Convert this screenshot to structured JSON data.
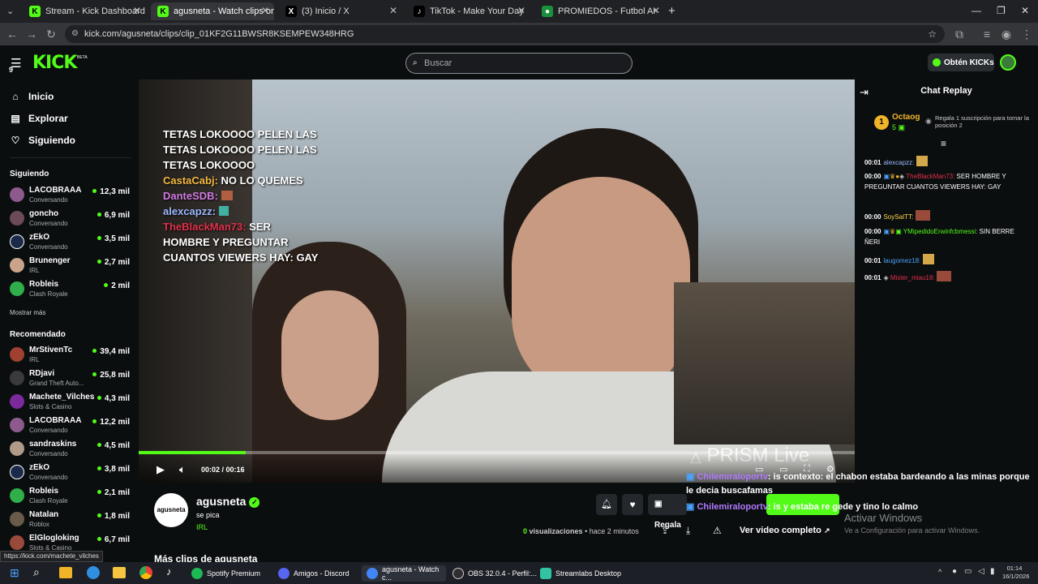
{
  "tabs": [
    {
      "label": "Stream - Kick Dashboard",
      "icon": "kick-icon"
    },
    {
      "label": "agusneta - Watch clips on Kick",
      "icon": "kick-icon"
    },
    {
      "label": "(3) Inicio / X",
      "icon": "x-icon"
    },
    {
      "label": "TikTok - Make Your Day",
      "icon": "tiktok-icon"
    },
    {
      "label": "PROMIEDOS - Futbol Argentino",
      "icon": "promiedos-icon"
    }
  ],
  "url": "kick.com/agusneta/clips/clip_01KF2G11BWSR8KSEMPEW348HRG",
  "header": {
    "logo": "KICK",
    "logo_badge": "BETA",
    "notif_count": "9",
    "search_placeholder": "Buscar",
    "get_kicks": "Obtén KICKs"
  },
  "nav": [
    {
      "label": "Inicio",
      "icon": "home-icon"
    },
    {
      "label": "Explorar",
      "icon": "compass-icon"
    },
    {
      "label": "Siguiendo",
      "icon": "heart-icon"
    }
  ],
  "following": {
    "title": "Siguiendo",
    "channels": [
      {
        "name": "LACOBRAAA",
        "category": "Conversando",
        "viewers": "12,3 mil"
      },
      {
        "name": "goncho",
        "category": "Conversando",
        "viewers": "6,9 mil"
      },
      {
        "name": "zEkO",
        "category": "Conversando",
        "viewers": "3,5 mil"
      },
      {
        "name": "Brunenger",
        "category": "IRL",
        "viewers": "2,7 mil"
      },
      {
        "name": "Robleis",
        "category": "Clash Royale",
        "viewers": "2 mil"
      }
    ],
    "show_more": "Mostrar más"
  },
  "recommended": {
    "title": "Recomendado",
    "channels": [
      {
        "name": "MrStivenTc",
        "category": "IRL",
        "viewers": "39,4 mil"
      },
      {
        "name": "RDjavi",
        "category": "Grand Theft Auto...",
        "viewers": "25,8 mil"
      },
      {
        "name": "Machete_Vilches",
        "category": "Slots & Casino",
        "viewers": "4,3 mil"
      },
      {
        "name": "LACOBRAAA",
        "category": "Conversando",
        "viewers": "12,2 mil"
      },
      {
        "name": "sandraskins",
        "category": "Conversando",
        "viewers": "4,5 mil"
      },
      {
        "name": "zEkO",
        "category": "Conversando",
        "viewers": "3,8 mil"
      },
      {
        "name": "Robleis",
        "category": "Clash Royale",
        "viewers": "2,1 mil"
      },
      {
        "name": "Natalan",
        "category": "Roblox",
        "viewers": "1,8 mil"
      },
      {
        "name": "ElGlogloking",
        "category": "Slots & Casino",
        "viewers": "6,7 mil"
      }
    ]
  },
  "status_url": "https://kick.com/machete_vilches",
  "video": {
    "time": "00:02 / 00:16",
    "progress": 0.15,
    "watermark": "PRISM Live",
    "overlay_lines": [
      "TETAS LOKOOOO PELEN LAS",
      "TETAS LOKOOOO PELEN LAS",
      "TETAS LOKOOOO"
    ],
    "overlay_chat": [
      {
        "user": "CastaCabj:",
        "text": "NO LO QUEMES"
      },
      {
        "user": "DanteSDB:",
        "text": ""
      },
      {
        "user": "alexcapzz:",
        "text": ""
      },
      {
        "user": "TheBlackMan73:",
        "text": "SER"
      }
    ],
    "overlay_tail": [
      "HOMBRE Y PREGUNTAR",
      "CUANTOS VIEWERS HAY: GAY"
    ]
  },
  "clip": {
    "streamer": "agusneta",
    "title": "se pica",
    "category": "IRL",
    "views": "0",
    "views_label": "visualizaciones",
    "ago": "hace 2 minutos",
    "gift_label": "Regala",
    "full_video": "Ver video completo",
    "more_clips": "Más clips de agusneta"
  },
  "chat": {
    "title": "Chat Replay",
    "top_user": "Octaog",
    "top_rank": "1",
    "top_subs": "5",
    "promo": "Regala 1 suscripción para tomar la posición 2",
    "messages": [
      {
        "time": "00:01",
        "user": "alexcapzz:",
        "color": "#9ab8ff",
        "text": ""
      },
      {
        "time": "00:00",
        "user": "TheBlackMan73:",
        "color": "#e0304a",
        "text": "SER HOMBRE Y PREGUNTAR CUANTOS VIEWERS HAY: GAY"
      },
      {
        "time": "00:00",
        "user": "SoySaITT:",
        "color": "#ffd84a",
        "text": ""
      },
      {
        "time": "00:00",
        "user": "YMipedidoErwinfcbmessi:",
        "color": "#53fc18",
        "text": "SIN BERRE ÑERI"
      },
      {
        "time": "00:01",
        "user": "laugomez18:",
        "color": "#4aa3ff",
        "text": ""
      },
      {
        "time": "00:01",
        "user": "Mister_miau18:",
        "color": "#e0304a",
        "text": ""
      }
    ]
  },
  "floating_chat": [
    {
      "user": "Chilemiraloportv",
      "text": ": is contexto: el chabon estaba bardeando a las minas porque le decia buscafamas"
    },
    {
      "user": "Chilemiraloportv",
      "text": ": is y estaba re gede y tino lo calmo"
    }
  ],
  "windows_watermark": {
    "title": "Activar Windows",
    "subtitle": "Ve a Configuración para activar Windows."
  },
  "taskbar": {
    "apps": [
      {
        "label": "Spotify Premium",
        "color": "#1db954"
      },
      {
        "label": "Amigos - Discord",
        "color": "#5865f2"
      },
      {
        "label": "agusneta - Watch c...",
        "color": "#4285f4"
      },
      {
        "label": "OBS 32.0.4 - Perfil:...",
        "color": "#302e31"
      },
      {
        "label": "Streamlabs Desktop",
        "color": "#31c3a2"
      }
    ],
    "time": "01:14",
    "date": "16/1/2026"
  }
}
